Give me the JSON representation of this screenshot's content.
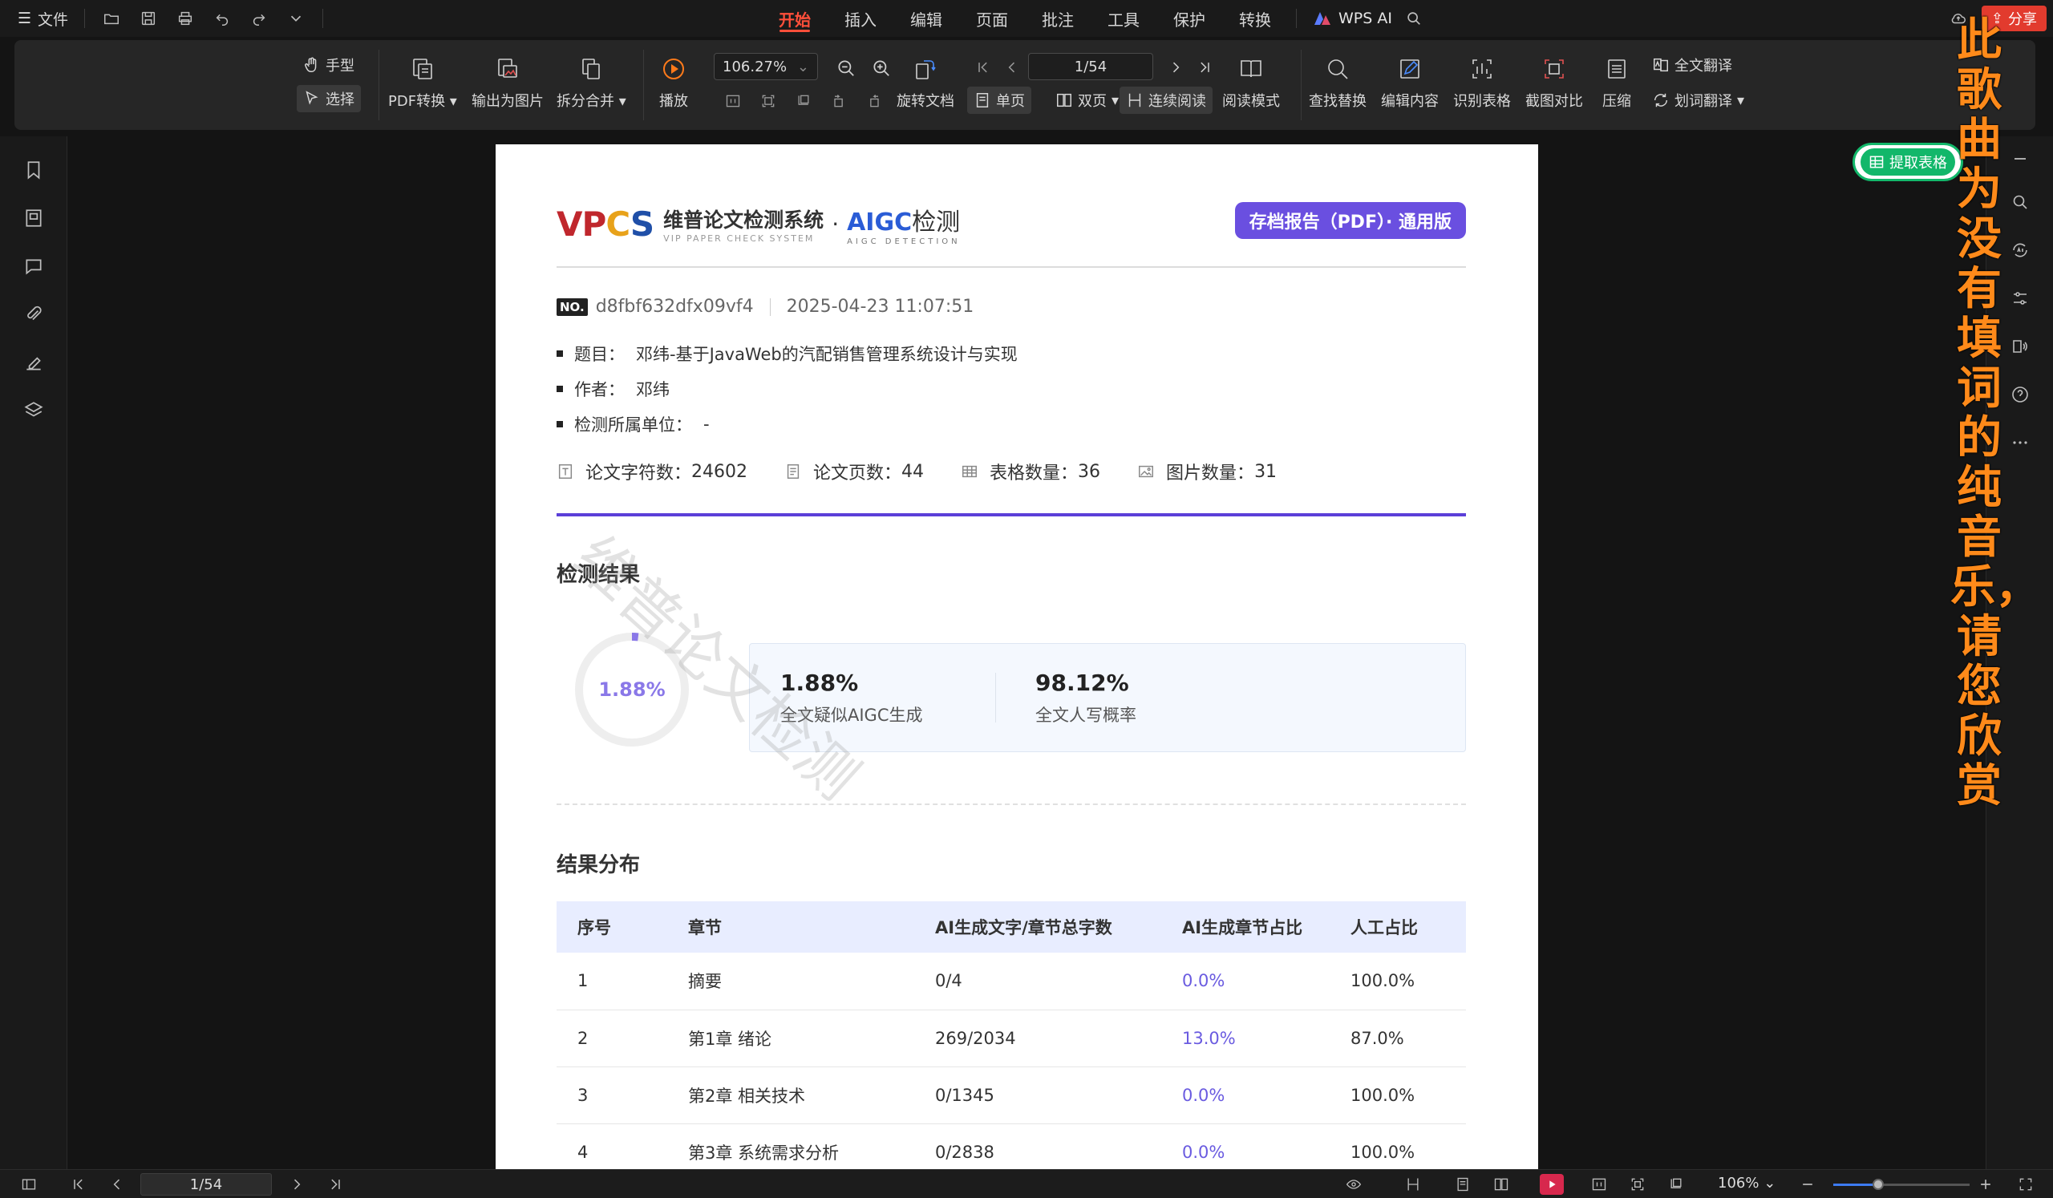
{
  "topbar": {
    "file_label": "文件",
    "tabs": [
      "开始",
      "插入",
      "编辑",
      "页面",
      "批注",
      "工具",
      "保护",
      "转换"
    ],
    "active_tab": "开始",
    "ai_label": "WPS AI",
    "share_label": "分享"
  },
  "ribbon": {
    "hand_label": "手型",
    "select_label": "选择",
    "pdf_convert": "PDF转换",
    "export_image": "输出为图片",
    "split_merge": "拆分合并",
    "play": "播放",
    "zoom_value": "106.27%",
    "page_value": "1/54",
    "rotate_doc": "旋转文档",
    "single_page": "单页",
    "double_page": "双页",
    "continuous": "连续阅读",
    "read_mode": "阅读模式",
    "find_replace": "查找替换",
    "edit_content": "编辑内容",
    "recognize_table": "识别表格",
    "screenshot_compare": "截图对比",
    "compress": "压缩",
    "full_translate": "全文翻译",
    "word_translate": "划词翻译"
  },
  "extract_table": "提取表格",
  "overlay_text": "此歌曲为没有填词的纯音乐，请您欣赏",
  "document": {
    "logo_vpcs": "VPCS",
    "logo_cn": "维普论文检测系统",
    "logo_en": "VIP PAPER CHECK SYSTEM",
    "logo_dot": "·",
    "logo_aigc": "AIGC",
    "logo_aigc_suffix": "检测",
    "logo_aigc_en": "AIGC DETECTION",
    "report_badge": "存档报告（PDF）· 通用版",
    "no_label": "NO.",
    "report_no": "d8fbf632dfx09vf4",
    "report_time": "2025-04-23 11:07:51",
    "title_key": "题目：",
    "title_val": "邓纬-基于JavaWeb的汽配销售管理系统设计与实现",
    "author_key": "作者：",
    "author_val": "邓纬",
    "unit_key": "检测所属单位：",
    "unit_val": "-",
    "stats": {
      "chars_label": "论文字符数：",
      "chars_val": "24602",
      "pages_label": "论文页数：",
      "pages_val": "44",
      "tables_label": "表格数量：",
      "tables_val": "36",
      "images_label": "图片数量：",
      "images_val": "31"
    },
    "result_title": "检测结果",
    "donut_value": "1.88%",
    "donut_fraction": 0.0188,
    "aigc_pct": "1.88%",
    "aigc_label": "全文疑似AIGC生成",
    "human_pct": "98.12%",
    "human_label": "全文人写概率",
    "dist_title": "结果分布",
    "table_headers": [
      "序号",
      "章节",
      "AI生成文字/章节总字数",
      "AI生成章节占比",
      "人工占比"
    ],
    "table_rows": [
      [
        "1",
        "摘要",
        "0/4",
        "0.0%",
        "100.0%"
      ],
      [
        "2",
        "第1章 绪论",
        "269/2034",
        "13.0%",
        "87.0%"
      ],
      [
        "3",
        "第2章 相关技术",
        "0/1345",
        "0.0%",
        "100.0%"
      ],
      [
        "4",
        "第3章 系统需求分析",
        "0/2838",
        "0.0%",
        "100.0%"
      ]
    ],
    "watermark": "维普论文检测"
  },
  "statusbar": {
    "page_value": "1/54",
    "zoom_value": "106%",
    "zoom_fraction": 0.33
  }
}
